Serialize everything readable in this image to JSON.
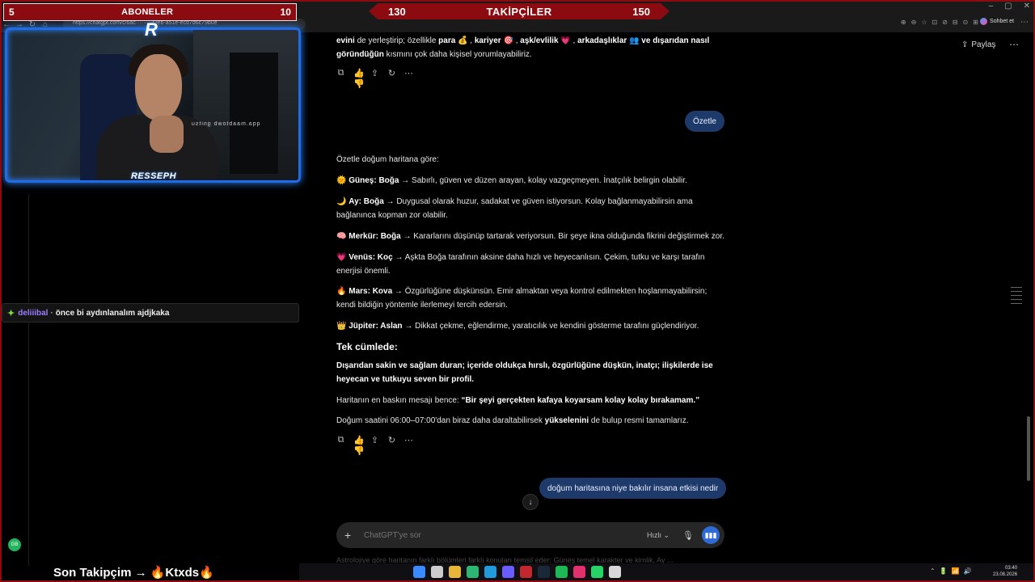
{
  "overlay": {
    "subscribers": {
      "current": "5",
      "label": "ABONELER",
      "goal": "10"
    },
    "followers": {
      "current": "130",
      "label": "TAKİPÇİLER",
      "goal": "150"
    },
    "accent_color": "#8b0b10",
    "webcam_caption": "qqa.maabtowb gnitsu",
    "webcam_logo": "R",
    "webcam_name": "RESSEPH",
    "last_follower": "Son Takipçim → 🔥Ktxds🔥"
  },
  "browser": {
    "url": "https://chatgpt.com/c/6ac·········f3eb-a51e-ecd7d6c79b0e",
    "sohbet_label": "Sohbet et",
    "nav": [
      "←",
      "→",
      "↻",
      "⌂"
    ],
    "win_controls": [
      "–",
      "▢",
      "✕"
    ],
    "extension_icons": [
      "⊕",
      "⊖",
      "☆",
      "⊡",
      "⊘",
      "⊟",
      "⊙",
      "⊞"
    ],
    "menu": "⋯"
  },
  "chat": {
    "message": {
      "user": "deliiibal",
      "separator": "·",
      "text": "önce bi aydınlanalım ajdjkaka",
      "user_color": "#9d7cff"
    },
    "badge": "GB"
  },
  "chatgpt": {
    "share_label": "Paylaş",
    "more": "⋯",
    "prev_answer": {
      "bold1": "evini",
      "t1": " de yerleştirip; özellikle ",
      "b2": "para",
      "e2": " 💰 , ",
      "b3": "kariyer",
      "e3": " 🎯 , ",
      "b4": "aşk/evlilik",
      "e4": " 💗 , ",
      "b5": "arkadaşlıklar",
      "e5": " 👥  ",
      "b6": "ve dışarıdan nasıl göründüğün",
      "t6": " kısmını çok daha kişisel yorumlayabiliriz."
    },
    "user_msg_1": "Özetle",
    "answer": {
      "intro": "Özetle doğum haritana göre:",
      "items": [
        {
          "emoji": "🌞",
          "label": "Güneş: Boğa",
          "text": " → Sabırlı, güven ve düzen arayan, kolay vazgeçmeyen. İnatçılık belirgin olabilir."
        },
        {
          "emoji": "🌙",
          "label": "Ay: Boğa",
          "text": " → Duygusal olarak huzur, sadakat ve güven istiyorsun. Kolay bağlanmayabilirsin ama bağlanınca kopman zor olabilir."
        },
        {
          "emoji": "🧠",
          "label": "Merkür: Boğa",
          "text": " → Kararlarını düşünüp tartarak veriyorsun. Bir şeye ikna olduğunda fikrini değiştirmek zor."
        },
        {
          "emoji": "💗",
          "label": "Venüs: Koç",
          "text": " → Aşkta Boğa tarafının aksine daha hızlı ve heyecanlısın. Çekim, tutku ve karşı tarafın enerjisi önemli."
        },
        {
          "emoji": "🔥",
          "label": "Mars: Kova",
          "text": " → Özgürlüğüne düşkünsün. Emir almaktan veya kontrol edilmekten hoşlanmayabilirsin; kendi bildiğin yöntemle ilerlemeyi tercih edersin."
        },
        {
          "emoji": "👑",
          "label": "Jüpiter: Aslan",
          "text": " → Dikkat çekme, eğlendirme, yaratıcılık ve kendini gösterme tarafını güçlendiriyor."
        }
      ],
      "heading": "Tek cümlede:",
      "summary": "Dışarıdan sakin ve sağlam duran; içeride oldukça hırslı, özgürlüğüne düşkün, inatçı; ilişkilerde ise heyecan ve tutkuyu seven bir profil.",
      "message_prefix": "Haritanın en baskın mesajı bence: ",
      "message_quote": "“Bir şeyi gerçekten kafaya koyarsam kolay kolay bırakamam.”",
      "closing_prefix": "Doğum saatini 06:00–07:00'dan biraz daha daraltabilirsek ",
      "closing_bold": "yükselenini",
      "closing_suffix": " de bulup resmi tamamlarız."
    },
    "action_icons": [
      "⧉",
      "👍👎",
      "⇪",
      "↻",
      "⋯"
    ],
    "user_msg_2": "doğum haritasına niye bakılır insana etkisi nedir",
    "composer": {
      "plus": "+",
      "placeholder": "ChatGPT'ye sor",
      "speed": "Hızlı ⌄",
      "mic": "🎙",
      "voice": "▮▮▮"
    },
    "scroll_down": "↓",
    "faded_preview": "Astrolojiye göre haritanın farklı bölümleri farklı konuları temsil eder: Güneş temel karakter ve kimlik, Ay ..."
  },
  "taskbar": {
    "icon_colors": [
      "#3a8bff",
      "#cccccc",
      "#e8b73a",
      "#2bb673",
      "#1f9bde",
      "#6a5cff",
      "#c1272d",
      "#1b2838",
      "#1db954",
      "#e1306c",
      "#25d366",
      "#d8d8d8"
    ],
    "tray": [
      "⌃",
      "🔋",
      "📶",
      "🔊"
    ],
    "time": "03:40",
    "date": "23.08.2026"
  }
}
